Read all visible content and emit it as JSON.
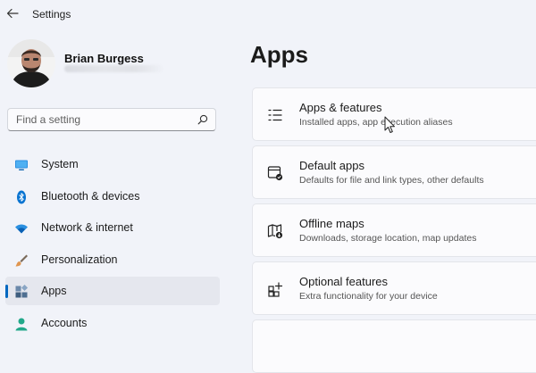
{
  "window": {
    "title": "Settings"
  },
  "user": {
    "name": "Brian Burgess"
  },
  "search": {
    "placeholder": "Find a setting"
  },
  "nav": [
    {
      "label": "System",
      "icon": "monitor-icon"
    },
    {
      "label": "Bluetooth & devices",
      "icon": "bluetooth-icon"
    },
    {
      "label": "Network & internet",
      "icon": "wifi-icon"
    },
    {
      "label": "Personalization",
      "icon": "brush-icon"
    },
    {
      "label": "Apps",
      "icon": "apps-icon",
      "selected": true
    },
    {
      "label": "Accounts",
      "icon": "person-icon"
    }
  ],
  "main": {
    "title": "Apps",
    "cards": [
      {
        "title": "Apps & features",
        "subtitle": "Installed apps, app execution aliases",
        "icon": "list-icon"
      },
      {
        "title": "Default apps",
        "subtitle": "Defaults for file and link types, other defaults",
        "icon": "default-apps-icon"
      },
      {
        "title": "Offline maps",
        "subtitle": "Downloads, storage location, map updates",
        "icon": "map-icon"
      },
      {
        "title": "Optional features",
        "subtitle": "Extra functionality for your device",
        "icon": "add-feature-icon"
      }
    ]
  },
  "colors": {
    "accent": "#0067c0",
    "background": "#f1f3f9",
    "card": "#fbfbfd"
  }
}
